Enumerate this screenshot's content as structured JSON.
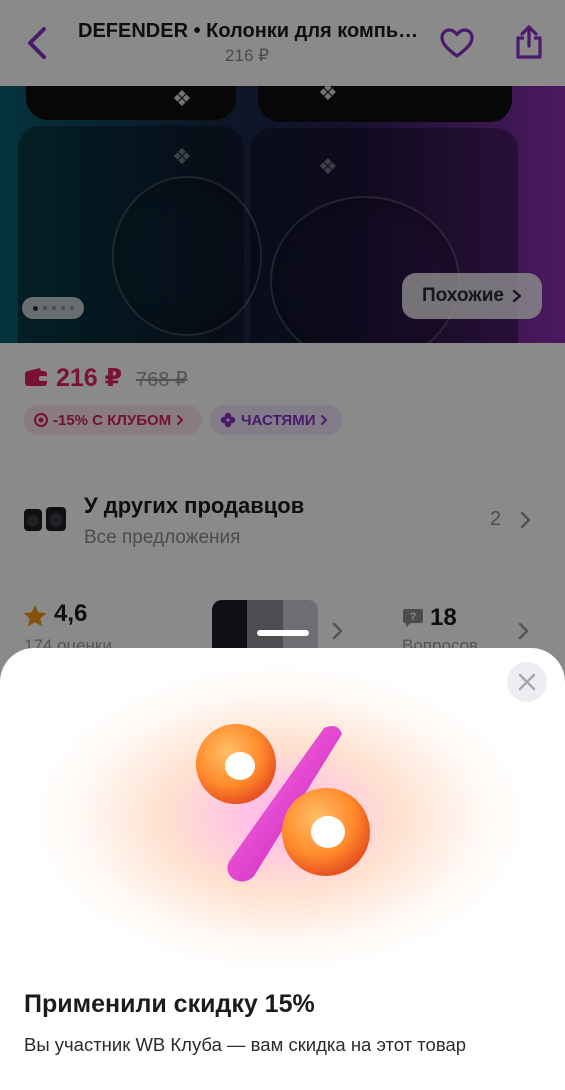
{
  "header": {
    "title": "DEFENDER • Колонки для компьютера",
    "price": "216 ₽"
  },
  "hero": {
    "similar_label": "Похожие"
  },
  "price": {
    "current": "216 ₽",
    "old": "768 ₽",
    "club_chip": "-15% С КЛУБОМ",
    "parts_chip": "ЧАСТЯМИ"
  },
  "sellers": {
    "title": "У других продавцов",
    "subtitle": "Все предложения",
    "count": "2"
  },
  "stats": {
    "rating": "4,6",
    "reviews": "174 оценки",
    "questions_count": "18",
    "questions_label": "Вопросов"
  },
  "sheet": {
    "title": "Применили скидку 15%",
    "text": "Вы участник WB Клуба — вам скидка на этот товар"
  },
  "colors": {
    "accent": "#8a2fc7",
    "price": "#e0245e"
  },
  "icons": [
    "back-arrow-icon",
    "heart-icon",
    "share-icon",
    "chevron-right-icon",
    "wallet-icon",
    "star-icon",
    "question-icon",
    "close-icon",
    "percent-icon"
  ]
}
